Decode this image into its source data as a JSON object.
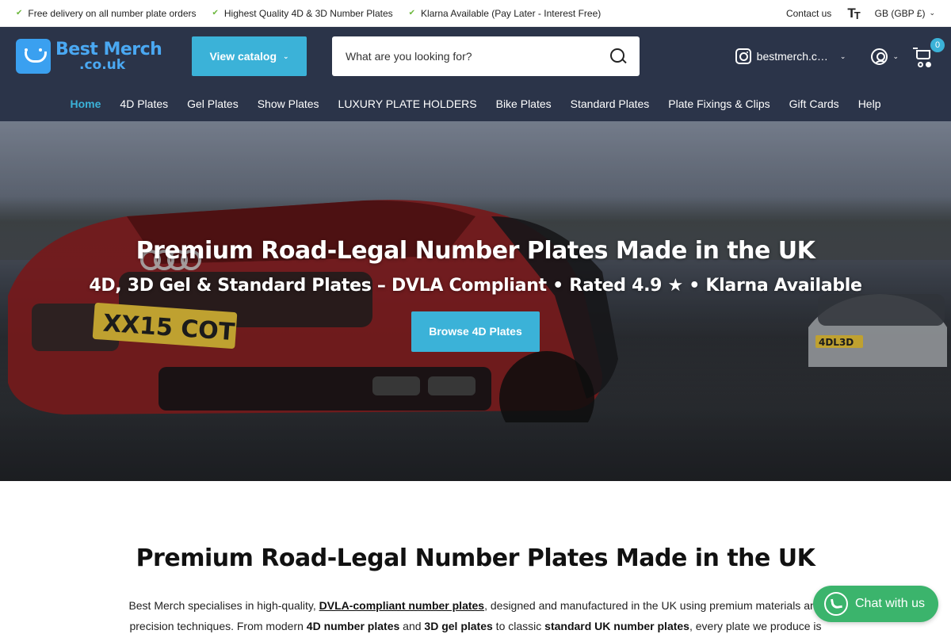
{
  "topbar": {
    "usps": [
      "Free delivery on all number plate orders",
      "Highest Quality 4D & 3D Number Plates",
      "Klarna Available (Pay Later - Interest Free)"
    ],
    "contact": "Contact us",
    "currency": "GB (GBP £)"
  },
  "header": {
    "logo_line1": "Best Merch",
    "logo_line2": ".co.uk",
    "catalog_label": "View catalog",
    "search_placeholder": "What are you looking for?",
    "instagram_handle": "bestmerch.c…",
    "cart_count": "0"
  },
  "nav": {
    "items": [
      "Home",
      "4D Plates",
      "Gel Plates",
      "Show Plates",
      "LUXURY PLATE HOLDERS",
      "Bike Plates",
      "Standard Plates",
      "Plate Fixings & Clips",
      "Gift Cards",
      "Help"
    ]
  },
  "hero": {
    "title": "Premium Road-Legal Number Plates Made in the UK",
    "subtitle": "4D, 3D Gel & Standard Plates – DVLA Compliant • Rated 4.9 ★ • Klarna Available",
    "button": "Browse 4D Plates",
    "plate_text": "XX15 COT",
    "plate_text_2": "4DL3D"
  },
  "intro": {
    "heading": "Premium Road-Legal Number Plates Made in the UK",
    "p_part1": "Best Merch specialises in high-quality, ",
    "p_link": "DVLA-compliant number plates",
    "p_part2": ", designed and manufactured in the UK using premium materials and precision techniques. From modern ",
    "p_b1": "4D number plates",
    "p_part3": " and ",
    "p_b2": "3D gel plates",
    "p_part4": " to classic ",
    "p_b3": "standard UK number plates",
    "p_part5": ", every plate we produce is"
  },
  "chat": {
    "label": "Chat with us"
  },
  "colors": {
    "header_bg": "#2b3449",
    "accent": "#3bb2d8",
    "check": "#6bb73b",
    "chat": "#3bb46c"
  }
}
